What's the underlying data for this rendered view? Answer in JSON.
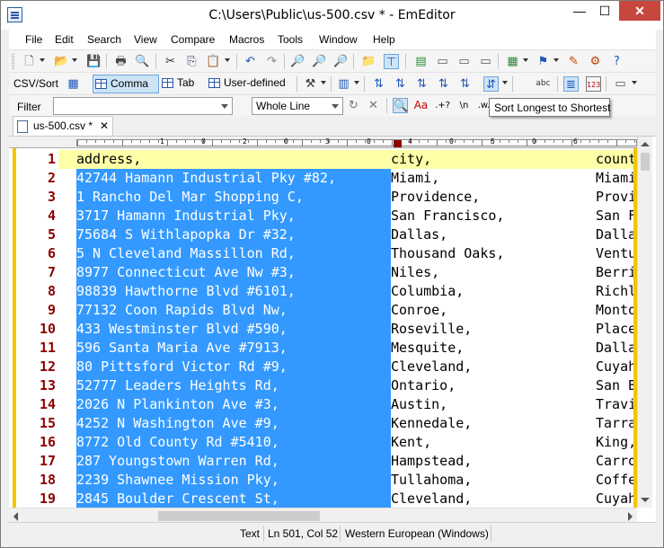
{
  "window": {
    "title": "C:\\Users\\Public\\us-500.csv * - EmEditor",
    "minimize_glyph": "—",
    "maximize_glyph": "☐",
    "close_glyph": "✕"
  },
  "menu": [
    "File",
    "Edit",
    "Search",
    "View",
    "Compare",
    "Macros",
    "Tools",
    "Window",
    "Help"
  ],
  "csv_toolbar": {
    "csv_sort_label": "CSV/Sort",
    "comma_label": "Comma",
    "tab_label": "Tab",
    "user_defined_label": "User-defined"
  },
  "filter_bar": {
    "label": "Filter",
    "filter_value": "",
    "mode": "Whole Line",
    "regex_label": ".+?",
    "escape_label": "\\n",
    "word_label": ".w."
  },
  "tooltip": "Sort Longest to Shortest",
  "document_tab": {
    "label": "us-500.csv *"
  },
  "ruler": {
    "labels": [
      "1",
      "0",
      "2",
      "0",
      "3",
      "0",
      "4",
      "0",
      "5",
      "0",
      "6"
    ]
  },
  "table": {
    "header": [
      "address,",
      "city,",
      "count"
    ],
    "rows": [
      [
        "42744 Hamann Industrial Pky #82,",
        "Miami,",
        "Miami"
      ],
      [
        "1 Rancho Del Mar Shopping C,",
        "Providence,",
        "Provi"
      ],
      [
        "3717 Hamann Industrial Pky,",
        "San Francisco,",
        "San F"
      ],
      [
        "75684 S Withlapopka Dr #32,",
        "Dallas,",
        "Dalla"
      ],
      [
        "5 N Cleveland Massillon Rd,",
        "Thousand Oaks,",
        "Ventu"
      ],
      [
        "8977 Connecticut Ave Nw #3,",
        "Niles,",
        "Berri"
      ],
      [
        "98839 Hawthorne Blvd #6101,",
        "Columbia,",
        "Richl"
      ],
      [
        "77132 Coon Rapids Blvd Nw,",
        "Conroe,",
        "Monto"
      ],
      [
        "433 Westminster Blvd #590,",
        "Roseville,",
        "Place"
      ],
      [
        "596 Santa Maria Ave #7913,",
        "Mesquite,",
        "Dalla"
      ],
      [
        "80 Pittsford Victor Rd #9,",
        "Cleveland,",
        "Cuyah"
      ],
      [
        "52777 Leaders Heights Rd,",
        "Ontario,",
        "San B"
      ],
      [
        "2026 N Plankinton Ave #3,",
        "Austin,",
        "Travi"
      ],
      [
        "4252 N Washington Ave #9,",
        "Kennedale,",
        "Tarra"
      ],
      [
        "8772 Old County Rd #5410,",
        "Kent,",
        "King,"
      ],
      [
        "287 Youngstown Warren Rd,",
        "Hampstead,",
        "Carro"
      ],
      [
        "2239 Shawnee Mission Pky,",
        "Tullahoma,",
        "Coffe"
      ],
      [
        "2845 Boulder Crescent St,",
        "Cleveland,",
        "Cuyah"
      ]
    ],
    "line_numbers": [
      "1",
      "2",
      "3",
      "4",
      "5",
      "6",
      "7",
      "8",
      "9",
      "10",
      "11",
      "12",
      "13",
      "14",
      "15",
      "16",
      "17",
      "18",
      "19"
    ]
  },
  "status_bar": {
    "mode": "Text",
    "position": "Ln 501, Col 52",
    "encoding": "Western European (Windows)"
  },
  "colors": {
    "selection": "#3399ff",
    "header_row": "#ffffa8",
    "line_number": "#8b0000",
    "close_button": "#c7463d"
  }
}
